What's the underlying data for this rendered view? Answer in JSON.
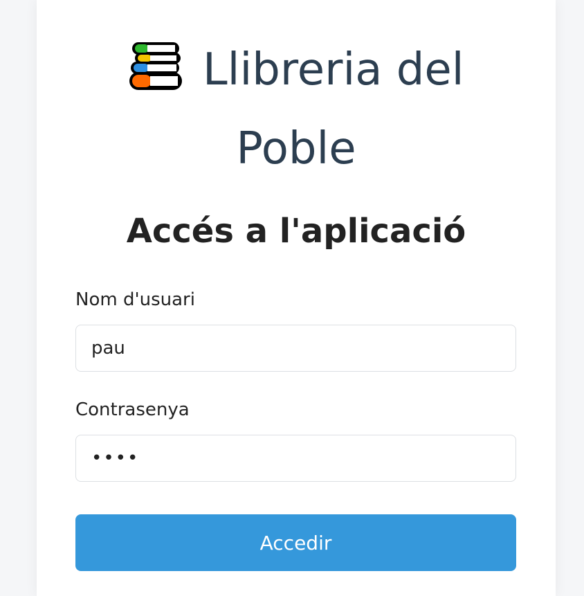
{
  "brand": {
    "line1": "Llibreria del",
    "line2": "Poble",
    "icon": "books-icon"
  },
  "heading": "Accés a l'aplicació",
  "form": {
    "username_label": "Nom d'usuari",
    "username_value": "pau",
    "password_label": "Contrasenya",
    "password_value": "••••",
    "submit_label": "Accedir"
  },
  "colors": {
    "page_background": "#f5f6f8",
    "card_background": "#ffffff",
    "brand_text": "#2c3e50",
    "button_primary": "#3598db",
    "button_text": "#ffffff",
    "input_border": "#dcdfe3"
  }
}
